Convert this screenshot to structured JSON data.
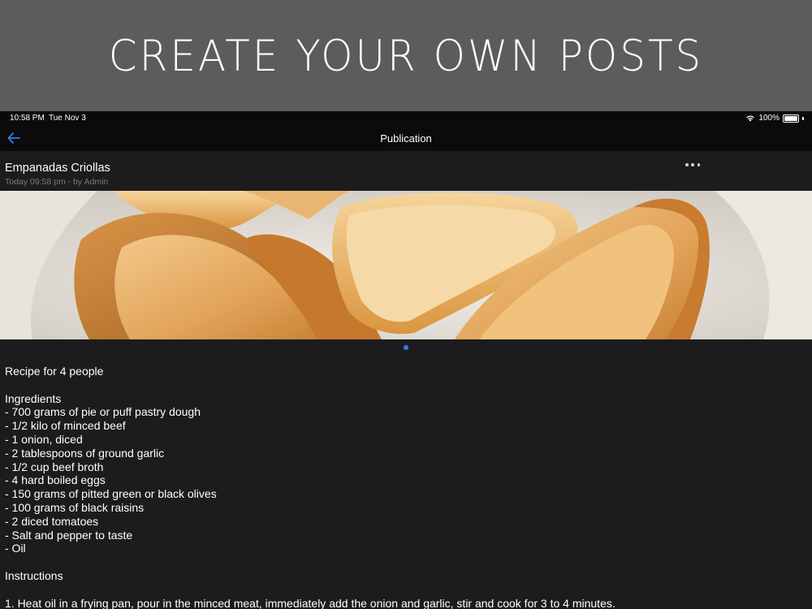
{
  "banner": {
    "title": "CREATE YOUR OWN POSTS"
  },
  "status_bar": {
    "time": "10:58 PM",
    "date": "Tue Nov 3",
    "battery": "100%",
    "battery_level": 1.0
  },
  "nav": {
    "title": "Publication",
    "back_icon": "arrow-left-icon"
  },
  "post": {
    "title": "Empanadas Criollas",
    "meta": "Today 09:58 pm - by Admin",
    "more_icon": "ellipsis-icon",
    "image_alt": "fried empanadas on a plate",
    "page_count": 1,
    "body": {
      "intro": "Recipe for 4 people",
      "ingredients_heading": "Ingredients",
      "ingredients": [
        "- 700 grams of pie or puff pastry dough",
        "- 1/2 kilo of minced beef",
        "- 1 onion, diced",
        "- 2 tablespoons of ground garlic",
        "- 1/2 cup beef broth",
        "- 4 hard boiled eggs",
        "- 150 grams of pitted green or black olives",
        "- 100 grams of black raisins",
        "- 2 diced tomatoes",
        "- Salt and pepper to taste",
        "- Oil"
      ],
      "instructions_heading": "Instructions",
      "instructions": [
        "1. Heat oil in a frying pan, pour in the minced meat, immediately add the onion and garlic, stir and cook for 3 to 4 minutes."
      ]
    }
  },
  "colors": {
    "accent": "#2f7cf6",
    "background": "#1c1c1e",
    "banner": "#5c5c5c"
  }
}
